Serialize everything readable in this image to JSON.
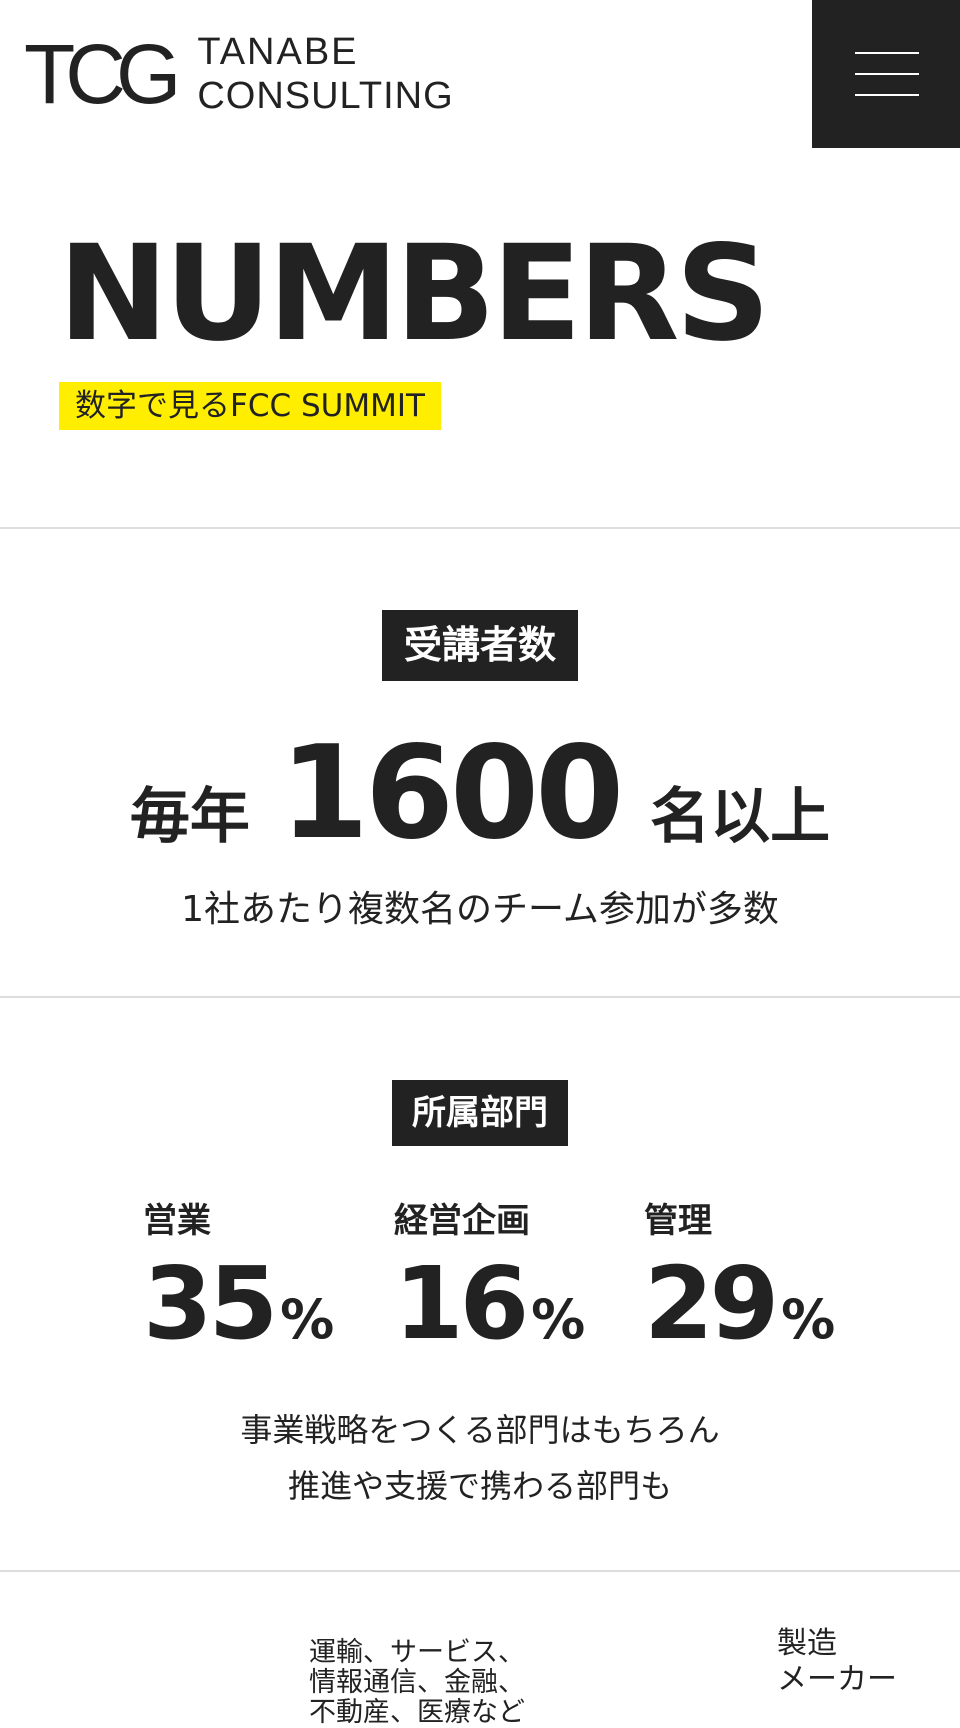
{
  "header": {
    "logo_mark": "TCG",
    "logo_line1": "TANABE",
    "logo_line2": "CONSULTING"
  },
  "title": {
    "main": "NUMBERS",
    "sub": "数字で見るFCC SUMMIT"
  },
  "attendees": {
    "label": "受講者数",
    "prefix": "毎年",
    "count": "1600",
    "unit": "名以上",
    "note": "1社あたり複数名のチーム参加が多数"
  },
  "departments": {
    "label": "所属部門",
    "items": [
      {
        "name": "営業",
        "value": "35",
        "unit": "%"
      },
      {
        "name": "経営企画",
        "value": "16",
        "unit": "%"
      },
      {
        "name": "管理",
        "value": "29",
        "unit": "%"
      }
    ],
    "note_line1": "事業戦略をつくる部門はもちろん",
    "note_line2": "推進や支援で携わる部門も"
  },
  "industries": {
    "left_line1": "運輸、サービス、",
    "left_line2": "情報通信、金融、",
    "left_line3": "不動産、医療など",
    "right_line1": "製造",
    "right_line2": "メーカー"
  },
  "colors": {
    "accent_yellow": "#ffee00",
    "dark": "#222222",
    "divider": "#dddddd"
  }
}
